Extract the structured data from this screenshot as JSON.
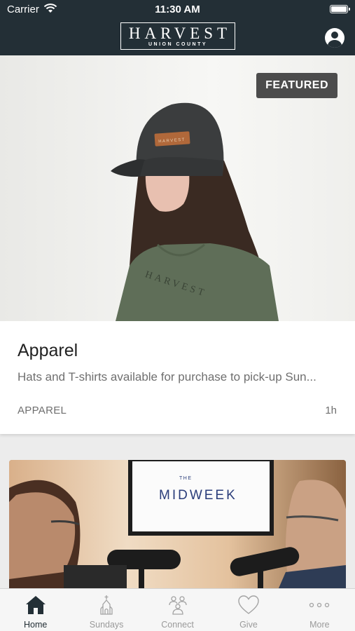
{
  "status_bar": {
    "carrier": "Carrier",
    "time": "11:30 AM"
  },
  "header": {
    "logo_word": "HARVEST",
    "logo_sub": "UNION COUNTY",
    "profile_icon": "profile-icon"
  },
  "featured": {
    "badge": "FEATURED",
    "title": "Apparel",
    "description": "Hats and T-shirts available for purchase to pick-up Sun...",
    "category": "APPAREL",
    "time": "1h",
    "image_text": "HARVEST"
  },
  "second_card": {
    "screen_small": "THE",
    "screen_word": "MIDWEEK"
  },
  "tabs": [
    {
      "label": "Home",
      "icon": "home-icon",
      "active": true
    },
    {
      "label": "Sundays",
      "icon": "church-icon",
      "active": false
    },
    {
      "label": "Connect",
      "icon": "people-icon",
      "active": false
    },
    {
      "label": "Give",
      "icon": "heart-icon",
      "active": false
    },
    {
      "label": "More",
      "icon": "more-icon",
      "active": false
    }
  ],
  "colors": {
    "header": "#232f36",
    "badge": "#4c4c4c",
    "tab_active": "#232f36",
    "tab_inactive": "#9a9a9a"
  }
}
